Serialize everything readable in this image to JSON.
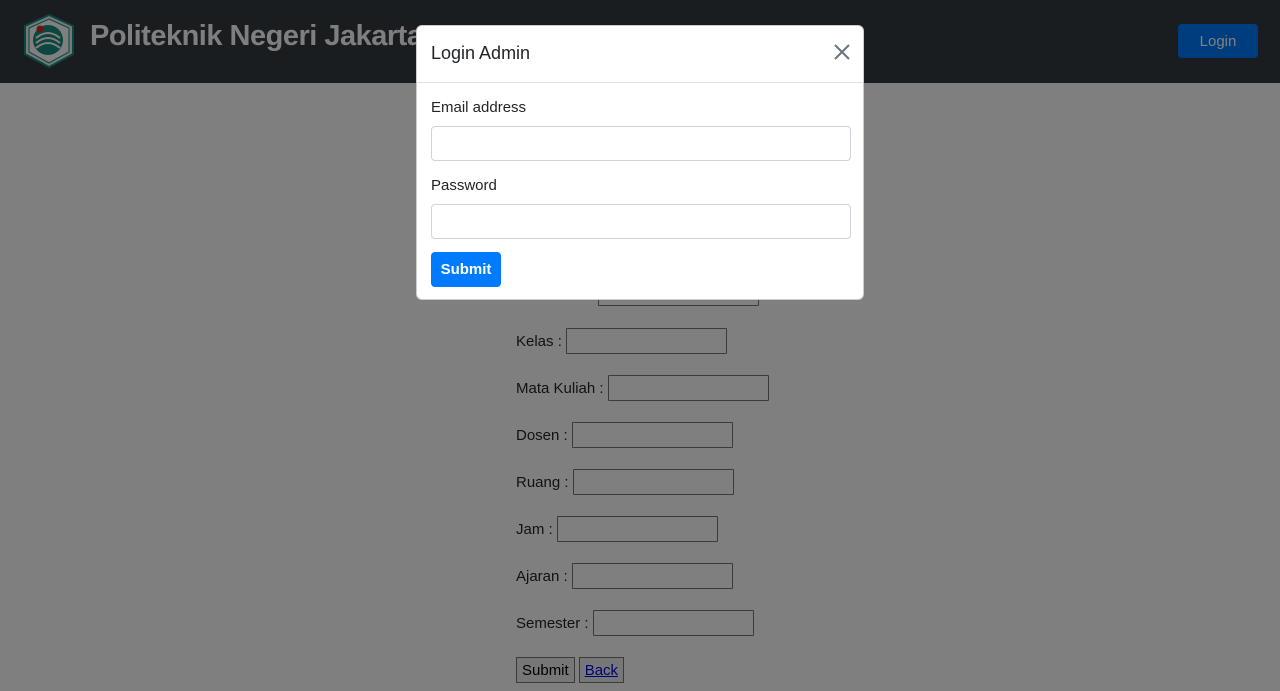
{
  "navbar": {
    "brand_title": "Politeknik Negeri Jakarta",
    "login_label": "Login"
  },
  "background_form": {
    "fields": [
      {
        "label": "Kelas :"
      },
      {
        "label": "Mata Kuliah :"
      },
      {
        "label": "Dosen :"
      },
      {
        "label": "Ruang :"
      },
      {
        "label": "Jam :"
      },
      {
        "label": "Ajaran :"
      },
      {
        "label": "Semester :"
      }
    ],
    "submit_label": "Submit",
    "back_label": "Back"
  },
  "modal": {
    "title": "Login Admin",
    "email_label": "Email address",
    "email_value": "",
    "password_label": "Password",
    "password_value": "",
    "submit_label": "Submit"
  },
  "colors": {
    "navbar_bg": "#343a40",
    "primary": "#007bff",
    "backdrop": "rgba(0,0,0,0.5)"
  }
}
